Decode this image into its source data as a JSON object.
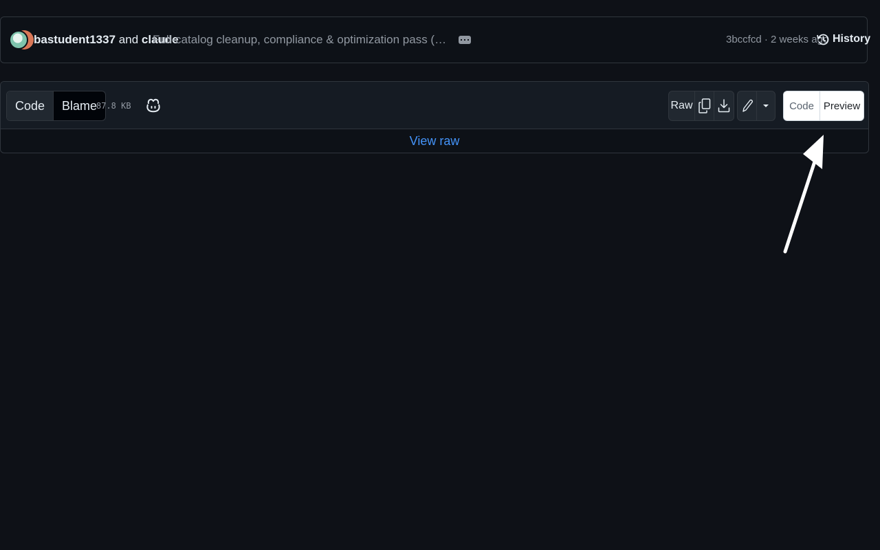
{
  "commit": {
    "author1": "bastudent1337",
    "conjunction": "and",
    "author2": "claude",
    "message": "Full-catalog cleanup, compliance & optimization pass (skill-creator +...",
    "meta": "3bccfcd · 2 weeks ago",
    "history_label": "History"
  },
  "file_header": {
    "tabs": [
      {
        "label": "Code",
        "active": true
      },
      {
        "label": "Blame",
        "active": false
      }
    ],
    "file_size": "87.8 KB",
    "raw_label": "Raw",
    "view_toggle": [
      {
        "label": "Code",
        "active": false
      },
      {
        "label": "Preview",
        "active": true
      }
    ]
  },
  "body": {
    "view_raw_label": "View raw"
  },
  "icons": {
    "ellipsis": "kebab-horizontal-icon",
    "history": "history-icon",
    "copilot": "copilot-icon",
    "copy": "copy-icon",
    "download": "download-icon",
    "edit": "pencil-icon",
    "dropdown": "triangle-down-icon",
    "annotation": "arrow-annotation"
  },
  "colors": {
    "background": "#0e1117",
    "link": "#4493f8",
    "border": "#30363d"
  }
}
